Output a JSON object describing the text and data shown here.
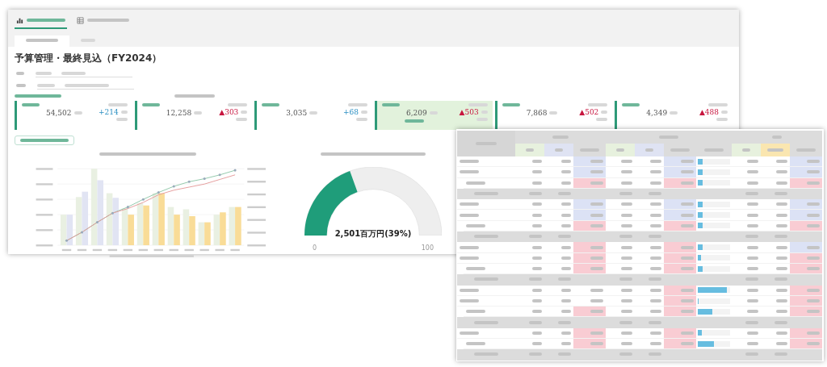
{
  "dashboard_title": "予算管理・最終見込（FY2024）",
  "kpi_cards": [
    {
      "value": "54,502",
      "delta": "+214",
      "decrease": false,
      "highlighted": false
    },
    {
      "value": "12,258",
      "delta": "▲303",
      "decrease": true,
      "highlighted": false
    },
    {
      "value": "3,035",
      "delta": "+68",
      "decrease": false,
      "highlighted": false
    },
    {
      "value": "6,209",
      "delta": "▲503",
      "decrease": true,
      "highlighted": true
    },
    {
      "value": "7,868",
      "delta": "▲502",
      "decrease": true,
      "highlighted": false
    },
    {
      "value": "4,349",
      "delta": "▲488",
      "decrease": true,
      "highlighted": false
    }
  ],
  "gauge": {
    "value_text": "2,501百万円(39%)",
    "min_label": "0",
    "max_label": "100",
    "level": 0.39
  },
  "table_rows": [
    {
      "kind": "item",
      "indented": false,
      "ratio_cells": [
        {
          "color": "#dce2f5"
        },
        {
          "color": "#dce2f5"
        },
        {
          "color": "#dce2f5"
        }
      ],
      "level": 0.15
    },
    {
      "kind": "item",
      "indented": false,
      "ratio_cells": [
        {
          "color": "#dce2f5"
        },
        {
          "color": "#dce2f5"
        },
        {
          "color": "#dce2f5"
        }
      ],
      "level": 0.15
    },
    {
      "kind": "item",
      "indented": true,
      "ratio_cells": [
        {
          "color": "#f9ccd3"
        },
        {
          "color": "#f9ccd3"
        },
        {
          "color": "#f9ccd3"
        }
      ],
      "level": 0.15
    },
    {
      "kind": "subtotal"
    },
    {
      "kind": "item",
      "indented": false,
      "ratio_cells": [
        {
          "color": "#dce2f5"
        },
        {
          "color": "#dce2f5"
        },
        {
          "color": "#dce2f5"
        }
      ],
      "level": 0.15
    },
    {
      "kind": "item",
      "indented": false,
      "ratio_cells": [
        {
          "color": "#dce2f5"
        },
        {
          "color": "#dce2f5"
        },
        {
          "color": "#dce2f5"
        }
      ],
      "level": 0.15
    },
    {
      "kind": "item",
      "indented": true,
      "ratio_cells": [
        {
          "color": "#f9ccd3"
        },
        {
          "color": "#f9ccd3"
        },
        {
          "color": "#f9ccd3"
        }
      ],
      "level": 0.15
    },
    {
      "kind": "subtotal"
    },
    {
      "kind": "item",
      "indented": false,
      "ratio_cells": [
        {
          "color": "#f9ccd3"
        },
        {
          "color": "#f9ccd3"
        },
        {
          "color": "#dce2f5"
        }
      ],
      "level": 0.15
    },
    {
      "kind": "item",
      "indented": false,
      "ratio_cells": [
        {
          "color": "#f9ccd3"
        },
        {
          "color": "#f9ccd3"
        },
        {
          "color": "#f9ccd3"
        }
      ],
      "level": 0.1
    },
    {
      "kind": "item",
      "indented": true,
      "ratio_cells": [
        {
          "color": "#f9ccd3"
        },
        {
          "color": "#f9ccd3"
        },
        {
          "color": "#f9ccd3"
        }
      ],
      "level": 0.15
    },
    {
      "kind": "subtotal"
    },
    {
      "kind": "item",
      "indented": false,
      "ratio_cells": [
        {
          "color": "#ffffff"
        },
        {
          "color": "#f9ccd3"
        },
        {
          "color": "#f9ccd3"
        }
      ],
      "level": 0.9
    },
    {
      "kind": "item",
      "indented": false,
      "ratio_cells": [
        {
          "color": "#ffffff"
        },
        {
          "color": "#f9ccd3"
        },
        {
          "color": "#f9ccd3"
        }
      ],
      "level": 0.03
    },
    {
      "kind": "item",
      "indented": true,
      "ratio_cells": [
        {
          "color": "#f9ccd3"
        },
        {
          "color": "#f9ccd3"
        },
        {
          "color": "#f9ccd3"
        }
      ],
      "level": 0.45
    },
    {
      "kind": "subtotal"
    },
    {
      "kind": "item",
      "indented": false,
      "ratio_cells": [
        {
          "color": "#f9ccd3"
        },
        {
          "color": "#f9ccd3"
        },
        {
          "color": "#f9ccd3"
        }
      ],
      "level": 0.12
    },
    {
      "kind": "item",
      "indented": true,
      "ratio_cells": [
        {
          "color": "#f9ccd3"
        },
        {
          "color": "#f9ccd3"
        },
        {
          "color": "#f9ccd3"
        }
      ],
      "level": 0.5
    },
    {
      "kind": "subtotal"
    }
  ]
}
